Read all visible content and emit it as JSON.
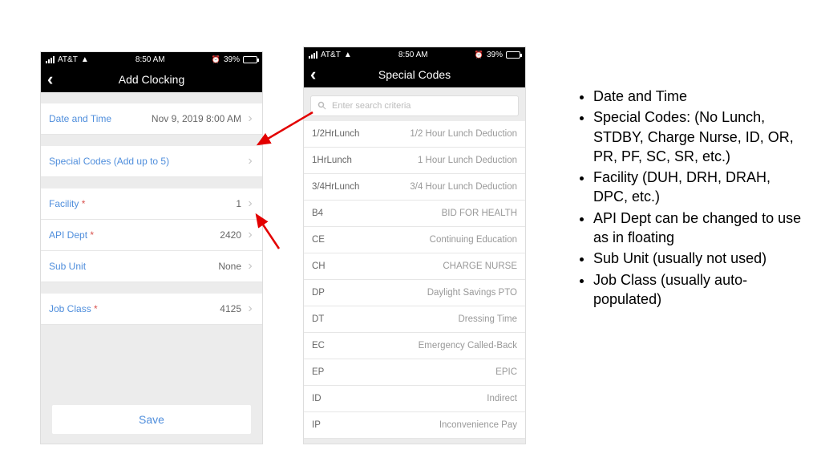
{
  "status": {
    "carrier": "AT&T",
    "time": "8:50 AM",
    "battery": "39%"
  },
  "phone1": {
    "title": "Add Clocking",
    "rows": {
      "datetime": {
        "label": "Date and Time",
        "value": "Nov 9, 2019 8:00 AM"
      },
      "special": {
        "label": "Special Codes (Add up to 5)",
        "value": ""
      },
      "facility": {
        "label": "Facility",
        "required": "*",
        "value": "1"
      },
      "apidept": {
        "label": "API Dept",
        "required": "*",
        "value": "2420"
      },
      "subunit": {
        "label": "Sub Unit",
        "value": "None"
      },
      "jobclass": {
        "label": "Job Class",
        "required": "*",
        "value": "4125"
      }
    },
    "save": "Save"
  },
  "phone2": {
    "title": "Special Codes",
    "search_placeholder": "Enter search criteria",
    "codes": [
      {
        "code": "1/2HrLunch",
        "desc": "1/2 Hour Lunch Deduction"
      },
      {
        "code": "1HrLunch",
        "desc": "1 Hour Lunch Deduction"
      },
      {
        "code": "3/4HrLunch",
        "desc": "3/4 Hour Lunch Deduction"
      },
      {
        "code": "B4",
        "desc": "BID FOR HEALTH"
      },
      {
        "code": "CE",
        "desc": "Continuing Education"
      },
      {
        "code": "CH",
        "desc": "CHARGE NURSE"
      },
      {
        "code": "DP",
        "desc": "Daylight Savings PTO"
      },
      {
        "code": "DT",
        "desc": "Dressing Time"
      },
      {
        "code": "EC",
        "desc": "Emergency Called-Back"
      },
      {
        "code": "EP",
        "desc": "EPIC"
      },
      {
        "code": "ID",
        "desc": "Indirect"
      },
      {
        "code": "IP",
        "desc": "Inconvenience Pay"
      }
    ]
  },
  "notes": [
    "Date and Time",
    "Special Codes: (No Lunch, STDBY, Charge Nurse, ID, OR, PR, PF, SC, SR, etc.)",
    "Facility (DUH, DRH, DRAH, DPC, etc.)",
    "API Dept can be changed to use as in floating",
    "Sub Unit (usually not used)",
    "Job Class (usually auto-populated)"
  ]
}
